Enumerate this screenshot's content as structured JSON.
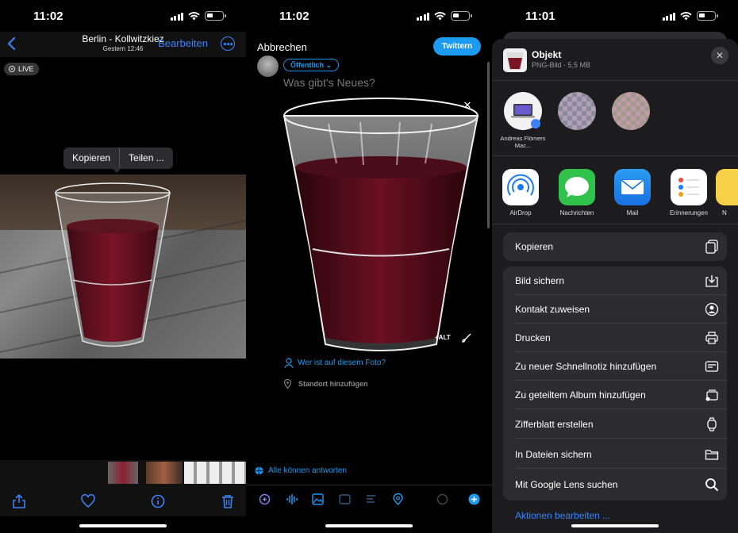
{
  "panel1": {
    "time": "11:02",
    "title": "Berlin - Kollwitzkiez",
    "subtitle": "Gestern  12:46",
    "edit_label": "Bearbeiten",
    "live_label": "LIVE",
    "menu": {
      "copy": "Kopieren",
      "share": "Teilen ..."
    },
    "icons": [
      "back-chevron-icon",
      "more-icon",
      "share-icon",
      "heart-icon",
      "info-icon",
      "trash-icon"
    ]
  },
  "panel2": {
    "time": "11:02",
    "cancel_label": "Abbrechen",
    "tweet_label": "Twittern",
    "audience_label": "Öffentlich",
    "placeholder": "Was gibt's Neues?",
    "alt_label": "+ALT",
    "tag_people": "Wer ist auf diesem Foto?",
    "add_location": "Standort hinzufügen",
    "reply_setting": "Alle können antworten",
    "accent": "#1d9bf0"
  },
  "panel3": {
    "time": "11:01",
    "object_title": "Objekt",
    "object_sub": "PNG-Bild · 5,5 MB",
    "people": [
      {
        "name": "Andreas Flömers Mac..."
      },
      {
        "name": ""
      },
      {
        "name": ""
      }
    ],
    "apps": [
      {
        "label": "AirDrop"
      },
      {
        "label": "Nachrichten"
      },
      {
        "label": "Mail"
      },
      {
        "label": "Erinnerungen"
      },
      {
        "label": "N"
      }
    ],
    "copy_action": "Kopieren",
    "actions": [
      "Bild sichern",
      "Kontakt zuweisen",
      "Drucken",
      "Zu neuer Schnellnotiz hinzufügen",
      "Zu geteiltem Album hinzufügen",
      "Zifferblatt erstellen",
      "In Dateien sichern",
      "Mit Google Lens suchen"
    ],
    "edit_actions": "Aktionen bearbeiten ...",
    "accent": "#3b82f6"
  }
}
